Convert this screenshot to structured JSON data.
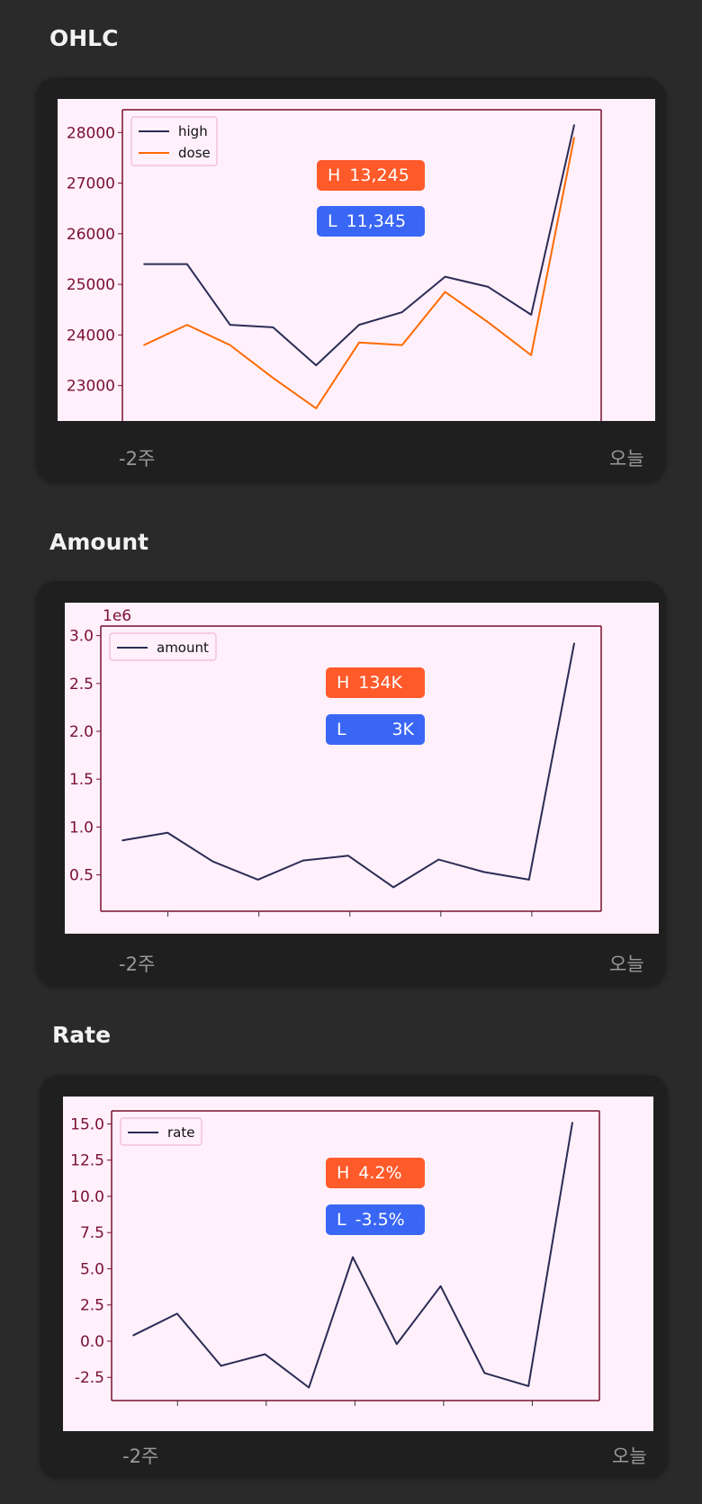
{
  "sections": [
    {
      "title": "OHLC",
      "badge_high": {
        "key": "H",
        "value": "13,245"
      },
      "badge_low": {
        "key": "L",
        "value": "11,345"
      },
      "foot_left": "-2주",
      "foot_right": "오늘"
    },
    {
      "title": "Amount",
      "badge_high": {
        "key": "H",
        "value": "134K"
      },
      "badge_low": {
        "key": "L",
        "value": "3K"
      },
      "foot_left": "-2주",
      "foot_right": "오늘"
    },
    {
      "title": "Rate",
      "badge_high": {
        "key": "H",
        "value": "4.2%"
      },
      "badge_low": {
        "key": "L",
        "value": "-3.5%"
      },
      "foot_left": "-2주",
      "foot_right": "오늘"
    }
  ],
  "colors": {
    "background": "#2a2a2a",
    "card": "#1f1f1f",
    "plot_background": "#fff0fb",
    "high_badge": "#ff5a2a",
    "low_badge": "#3a66f5",
    "series_dark": "#2b2b55",
    "series_orange": "#ff6a00",
    "axis_frame": "#7a1030"
  },
  "chart_data": [
    {
      "type": "line",
      "x": [
        0,
        1,
        2,
        3,
        4,
        5,
        6,
        7,
        8,
        9,
        10
      ],
      "series": [
        {
          "name": "high",
          "color": "#2b2b55",
          "values": [
            25400,
            25400,
            24200,
            24150,
            23400,
            24200,
            24450,
            25150,
            24950,
            24400,
            28150
          ]
        },
        {
          "name": "dose",
          "color": "#ff6a00",
          "values": [
            23800,
            24200,
            23800,
            23150,
            22550,
            23850,
            23800,
            24850,
            24250,
            23600,
            27900
          ]
        }
      ],
      "yticks": [
        23000,
        24000,
        25000,
        26000,
        27000,
        28000
      ],
      "ylim": [
        22300,
        28450
      ],
      "legend": "top-left",
      "grid": false
    },
    {
      "type": "line",
      "x": [
        0,
        1,
        2,
        3,
        4,
        5,
        6,
        7,
        8,
        9,
        10
      ],
      "series": [
        {
          "name": "amount",
          "color": "#2b2b55",
          "values": [
            0.86,
            0.94,
            0.64,
            0.45,
            0.65,
            0.7,
            0.37,
            0.66,
            0.53,
            0.45,
            2.92
          ]
        }
      ],
      "yticks": [
        0.5,
        1.0,
        1.5,
        2.0,
        2.5,
        3.0
      ],
      "ytick_labels": [
        "0.5",
        "1.0",
        "1.5",
        "2.0",
        "2.5",
        "3.0"
      ],
      "ylim": [
        0.12,
        3.1
      ],
      "offset_label": "1e6",
      "legend": "top-left",
      "grid": false
    },
    {
      "type": "line",
      "x": [
        0,
        1,
        2,
        3,
        4,
        5,
        6,
        7,
        8,
        9,
        10
      ],
      "series": [
        {
          "name": "rate",
          "color": "#2b2b55",
          "values": [
            0.4,
            1.9,
            -1.7,
            -0.9,
            -3.2,
            5.8,
            -0.2,
            3.8,
            -2.2,
            -3.1,
            15.1
          ]
        }
      ],
      "yticks": [
        -2.5,
        0.0,
        2.5,
        5.0,
        7.5,
        10.0,
        12.5,
        15.0
      ],
      "ytick_labels": [
        "-2.5",
        "0.0",
        "2.5",
        "5.0",
        "7.5",
        "10.0",
        "12.5",
        "15.0"
      ],
      "ylim": [
        -4.1,
        15.9
      ],
      "legend": "top-left",
      "grid": false
    }
  ]
}
